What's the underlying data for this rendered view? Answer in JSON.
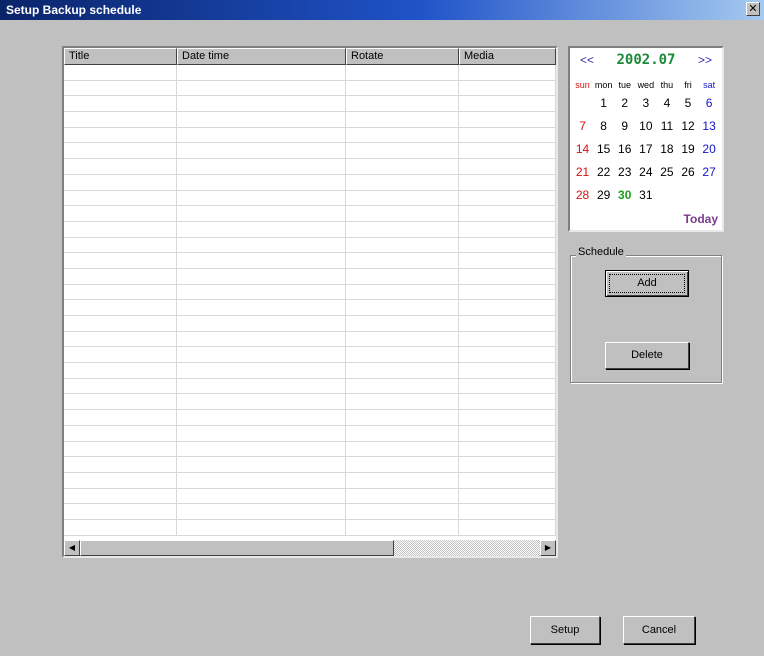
{
  "window": {
    "title": "Setup Backup schedule",
    "close_glyph": "✕"
  },
  "list": {
    "columns": [
      {
        "key": "title",
        "label": "Title"
      },
      {
        "key": "datetime",
        "label": "Date time"
      },
      {
        "key": "rotate",
        "label": "Rotate"
      },
      {
        "key": "media",
        "label": "Media"
      }
    ],
    "rows": []
  },
  "calendar": {
    "prev": "<<",
    "next": ">>",
    "month_label": "2002.07",
    "weekdays": [
      "sun",
      "mon",
      "tue",
      "wed",
      "thu",
      "fri",
      "sat"
    ],
    "weeks": [
      [
        "",
        "1",
        "2",
        "3",
        "4",
        "5",
        "6"
      ],
      [
        "7",
        "8",
        "9",
        "10",
        "11",
        "12",
        "13"
      ],
      [
        "14",
        "15",
        "16",
        "17",
        "18",
        "19",
        "20"
      ],
      [
        "21",
        "22",
        "23",
        "24",
        "25",
        "26",
        "27"
      ],
      [
        "28",
        "29",
        "30",
        "31",
        "",
        "",
        ""
      ]
    ],
    "highlighted_day": "30",
    "today_label": "Today",
    "colors": {
      "sunday": "#d81010",
      "saturday": "#1414c8",
      "highlight": "#18a018",
      "month": "#1b8a3a"
    }
  },
  "schedule": {
    "group_label": "Schedule",
    "add_label": "Add",
    "delete_label": "Delete"
  },
  "footer": {
    "setup_label": "Setup",
    "cancel_label": "Cancel"
  },
  "scrollbar": {
    "left_icon": "scroll-left-icon",
    "right_icon": "scroll-right-icon"
  }
}
